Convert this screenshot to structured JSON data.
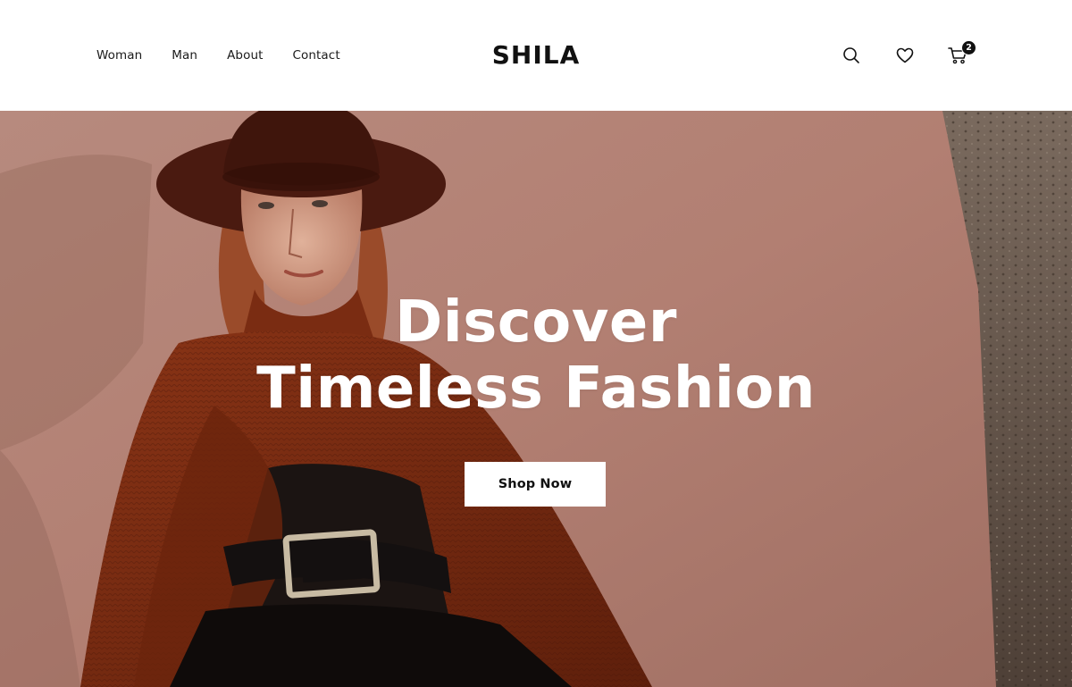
{
  "brand": {
    "logo": "SHILA"
  },
  "nav": {
    "items": [
      "Woman",
      "Man",
      "About",
      "Contact"
    ]
  },
  "header_icons": {
    "search": "search-icon",
    "wishlist": "heart-icon",
    "cart": "cart-icon",
    "cart_count": "2"
  },
  "hero": {
    "line1": "Discover",
    "line2": "Timeless Fashion",
    "cta_label": "Shop Now",
    "photo": "woman-in-brown-hat-and-rust-sweater-photo"
  },
  "colors": {
    "background": "#ffffff",
    "text": "#111111",
    "hero_wall": "#b8877a",
    "sweater": "#7a2c12",
    "hat": "#4a1a10",
    "button_bg": "#ffffff"
  }
}
